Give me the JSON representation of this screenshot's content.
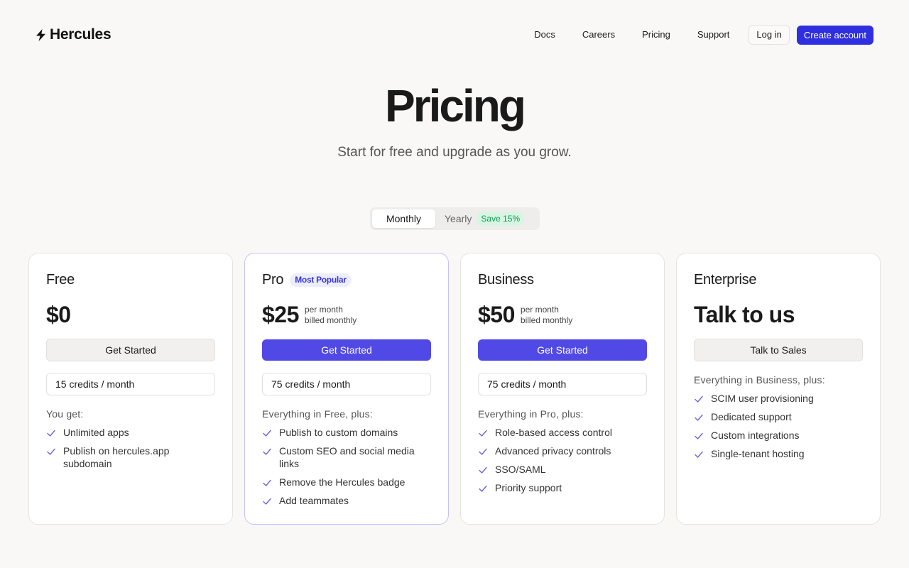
{
  "header": {
    "brand": "Hercules",
    "nav": [
      "Docs",
      "Careers",
      "Pricing",
      "Support"
    ],
    "login_label": "Log in",
    "create_label": "Create account"
  },
  "hero": {
    "title": "Pricing",
    "subtitle": "Start for free and upgrade as you grow."
  },
  "billing_toggle": {
    "monthly_label": "Monthly",
    "yearly_label": "Yearly",
    "save_badge": "Save 15%",
    "selected": "Monthly"
  },
  "plans": [
    {
      "name": "Free",
      "badge": "",
      "price": "$0",
      "price_note_1": "",
      "price_note_2": "",
      "cta": "Get Started",
      "credits": "15 credits / month",
      "features_heading": "You get:",
      "features": [
        "Unlimited apps",
        "Publish on hercules.app subdomain"
      ]
    },
    {
      "name": "Pro",
      "badge": "Most Popular",
      "price": "$25",
      "price_note_1": "per month",
      "price_note_2": "billed monthly",
      "cta": "Get Started",
      "credits": "75 credits / month",
      "features_heading": "Everything in Free, plus:",
      "features": [
        "Publish to custom domains",
        "Custom SEO and social media links",
        "Remove the Hercules badge",
        "Add teammates"
      ]
    },
    {
      "name": "Business",
      "badge": "",
      "price": "$50",
      "price_note_1": "per month",
      "price_note_2": "billed monthly",
      "cta": "Get Started",
      "credits": "75 credits / month",
      "features_heading": "Everything in Pro, plus:",
      "features": [
        "Role-based access control",
        "Advanced privacy controls",
        "SSO/SAML",
        "Priority support"
      ]
    },
    {
      "name": "Enterprise",
      "badge": "",
      "price": "Talk to us",
      "cta": "Talk to Sales",
      "features_heading": "Everything in Business, plus:",
      "features": [
        "SCIM user provisioning",
        "Dedicated support",
        "Custom integrations",
        "Single-tenant hosting"
      ]
    }
  ],
  "colors": {
    "accent": "#2f2fe0",
    "primary_button": "#5149e6",
    "check": "#6b63e0",
    "save_badge_text": "#0f9a52"
  }
}
